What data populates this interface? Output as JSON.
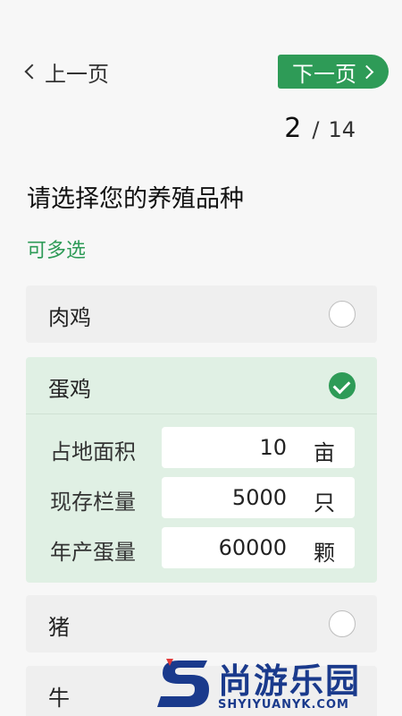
{
  "nav": {
    "prev_label": "上一页",
    "next_label": "下一页"
  },
  "progress": {
    "current": "2",
    "separator": "/",
    "total": "14"
  },
  "question": {
    "title": "请选择您的养殖品种",
    "hint": "可多选"
  },
  "options": [
    {
      "label": "肉鸡",
      "selected": false
    },
    {
      "label": "蛋鸡",
      "selected": true,
      "fields": [
        {
          "label": "占地面积",
          "value": "10",
          "unit": "亩"
        },
        {
          "label": "现存栏量",
          "value": "5000",
          "unit": "只"
        },
        {
          "label": "年产蛋量",
          "value": "60000",
          "unit": "颗"
        }
      ]
    },
    {
      "label": "猪",
      "selected": false
    },
    {
      "label": "牛",
      "selected": false
    }
  ],
  "watermark": {
    "name": "尚游乐园",
    "url": "SHYIYUANYK.COM"
  },
  "colors": {
    "accent": "#2e9b57",
    "selected_bg": "#e0f0e4",
    "option_bg": "#efefef",
    "watermark": "#1a3a8c"
  }
}
